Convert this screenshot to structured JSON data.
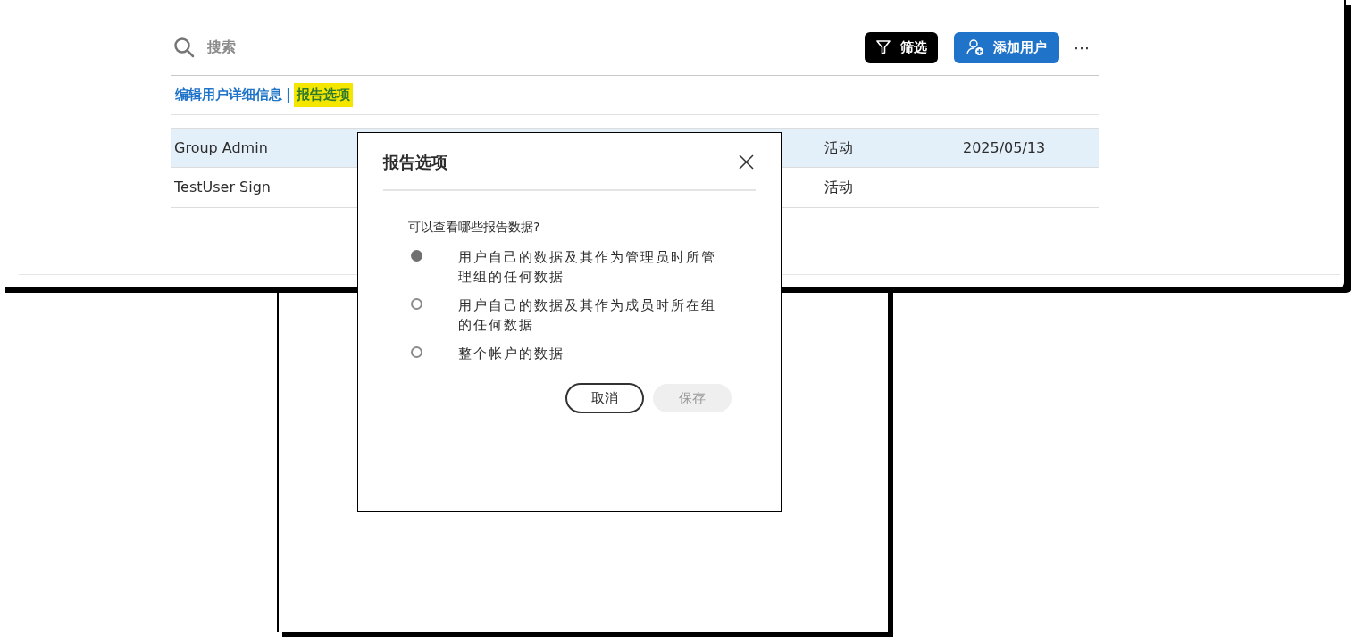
{
  "search": {
    "placeholder": "搜索"
  },
  "toolbar": {
    "filter_button": "筛选",
    "add_user_button": "添加用户",
    "more_button": "⋯"
  },
  "links": [
    {
      "label": "编辑用户详细信息",
      "selected": false
    },
    {
      "label": "报告选项",
      "selected": true
    }
  ],
  "link_separator": "|",
  "table": {
    "rows": [
      {
        "name": "Group Admin",
        "status": "活动",
        "date": "2025/05/13",
        "selected": true
      },
      {
        "name": "TestUser Sign",
        "status": "活动",
        "selected": false
      }
    ]
  },
  "dialog": {
    "title": "报告选项",
    "question": "可以查看哪些报告数据?",
    "options": [
      {
        "label": "用户自己的数据及其作为管理员时所管理组的任何数据",
        "selected": true
      },
      {
        "label": "用户自己的数据及其作为成员时所在组的任何数据",
        "selected": false
      },
      {
        "label": "整个帐户的数据",
        "selected": false
      }
    ],
    "cancel_button": "取消",
    "save_button": {
      "label": "保存",
      "disabled": true
    }
  }
}
